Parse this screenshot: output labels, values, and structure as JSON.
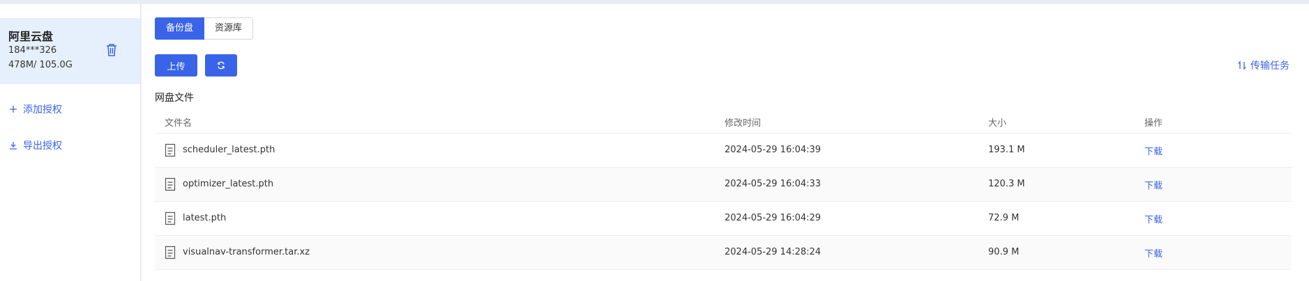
{
  "sidebar": {
    "account": {
      "name": "阿里云盘",
      "uid": "184***326",
      "quota": "478M/ 105.0G",
      "delete_icon": "trash-icon"
    },
    "add_auth": "添加授权",
    "export_auth": "导出授权"
  },
  "main": {
    "tabs": [
      {
        "label": "备份盘",
        "active": true
      },
      {
        "label": "资源库",
        "active": false
      }
    ],
    "upload_label": "上传",
    "refresh_icon": "refresh-icon",
    "transfer_label": "传输任务",
    "section_title": "网盘文件",
    "table": {
      "headers": [
        "文件名",
        "修改时间",
        "大小",
        "操作"
      ],
      "rows": [
        {
          "name": "scheduler_latest.pth",
          "time": "2024-05-29 16:04:39",
          "size": "193.1 M",
          "op": "下载"
        },
        {
          "name": "optimizer_latest.pth",
          "time": "2024-05-29 16:04:33",
          "size": "120.3 M",
          "op": "下载"
        },
        {
          "name": "latest.pth",
          "time": "2024-05-29 16:04:29",
          "size": "72.9 M",
          "op": "下载"
        },
        {
          "name": "visualnav-transformer.tar.xz",
          "time": "2024-05-29 14:28:24",
          "size": "90.9 M",
          "op": "下载"
        }
      ]
    }
  },
  "colors": {
    "accent": "#3a64e8",
    "selected_bg": "#e6f0fc"
  }
}
